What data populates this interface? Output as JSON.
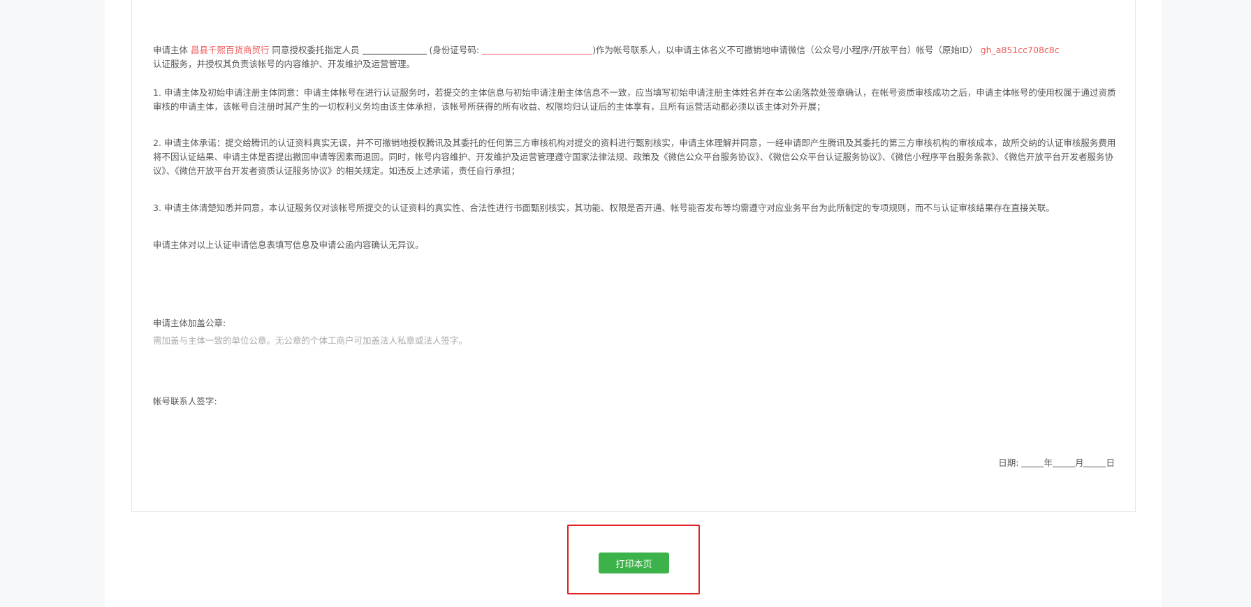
{
  "intro": {
    "subject_prefix": "申请主体",
    "subject_name": "昌县千熙百货商贸行",
    "authorize_text": "同意授权委托指定人员",
    "id_label": "(身份证号码:",
    "contact_text": ")作为帐号联系人，以申请主体名义不可撤销地申请微信（公众号/小程序/开放平台）帐号（原始ID）",
    "original_id": "gh_a851cc708c8c",
    "line2": "认证服务，并授权其负责该帐号的内容维护、开发维护及运营管理。"
  },
  "clauses": [
    "1. 申请主体及初始申请注册主体同意：申请主体帐号在进行认证服务时，若提交的主体信息与初始申请注册主体信息不一致，应当填写初始申请注册主体姓名并在本公函落款处签章确认，在帐号资质审核成功之后，申请主体帐号的使用权属于通过资质审核的申请主体，该帐号自注册时其产生的一切权利义务均由该主体承担，该帐号所获得的所有收益、权限均归认证后的主体享有，且所有运营活动都必须以该主体对外开展；",
    "2. 申请主体承诺：提交给腾讯的认证资料真实无误，并不可撤销地授权腾讯及其委托的任何第三方审核机构对提交的资料进行甄别核实，申请主体理解并同意，一经申请即产生腾讯及其委托的第三方审核机构的审核成本，故所交纳的认证审核服务费用将不因认证结果、申请主体是否提出撤回申请等因素而退回。同时，帐号内容维护、开发维护及运营管理遵守国家法律法规、政策及《微信公众平台服务协议》、《微信公众平台认证服务协议》、《微信小程序平台服务条款》、《微信开放平台开发者服务协议》、《微信开放平台开发者资质认证服务协议》的相关规定。如违反上述承诺，责任自行承担；",
    "3. 申请主体清楚知悉并同意，本认证服务仅对该帐号所提交的认证资料的真实性、合法性进行书面甄别核实，其功能、权限是否开通、帐号能否发布等均需遵守对应业务平台为此所制定的专项规则，而不与认证审核结果存在直接关联。",
    "申请主体对以上认证申请信息表填写信息及申请公函内容确认无异议。"
  ],
  "seal": {
    "label": "申请主体加盖公章:",
    "hint": "需加盖与主体一致的单位公章。无公章的个体工商户可加盖法人私章或法人签字。"
  },
  "sign": {
    "label": "帐号联系人签字:"
  },
  "date": {
    "label": "日期:",
    "year": "年",
    "month": "月",
    "day": "日"
  },
  "actions": {
    "print_label": "打印本页"
  },
  "colors": {
    "accent_red": "#f25a5a",
    "button_green": "#3cb34a",
    "highlight_red": "#e02020"
  }
}
